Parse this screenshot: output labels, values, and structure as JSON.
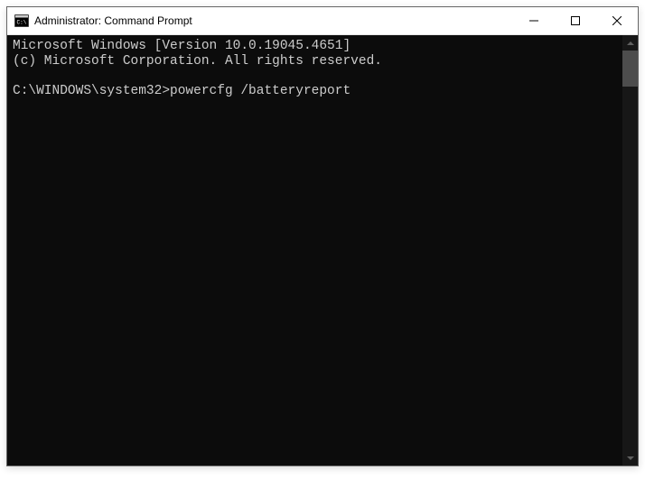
{
  "window": {
    "title": "Administrator: Command Prompt"
  },
  "terminal": {
    "line1": "Microsoft Windows [Version 10.0.19045.4651]",
    "line2": "(c) Microsoft Corporation. All rights reserved.",
    "blank": "",
    "prompt": "C:\\WINDOWS\\system32>",
    "command": "powercfg /batteryreport"
  }
}
